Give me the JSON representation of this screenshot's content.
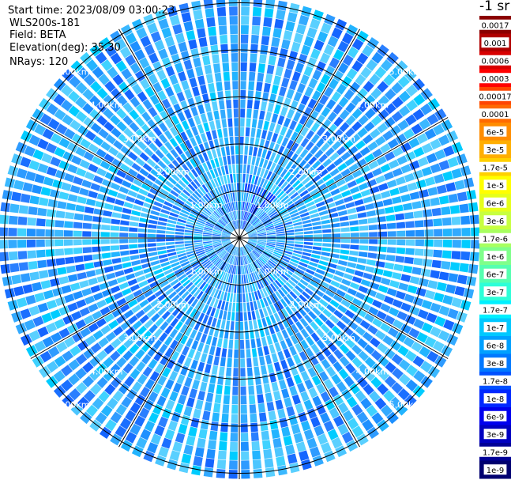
{
  "info": {
    "start_time": "Start time: 2023/08/09 03:00:23",
    "station": "WLS200s-181",
    "field": "Field: BETA",
    "elevation": "Elevation(deg): 35.30",
    "nrays": "NRays: 120"
  },
  "chart_data": {
    "type": "heatmap",
    "projection": "polar-ppi",
    "field": "BETA",
    "n_rays": 120,
    "elevation_deg": 35.3,
    "range_rings_km": [
      1,
      2,
      3,
      4,
      5
    ],
    "range_labels": [
      "1.00km",
      "2.00km",
      "3.00km",
      "4.00km",
      "5.00km"
    ],
    "grid": true,
    "colorbar": {
      "unit_label": "-1 sr",
      "placement": "right",
      "ticks": [
        "0.0017",
        "0.001",
        "0.0006",
        "0.0003",
        "0.00017",
        "0.0001",
        "6e-5",
        "3e-5",
        "1.7e-5",
        "1e-5",
        "6e-6",
        "3e-6",
        "1.7e-6",
        "1e-6",
        "6e-7",
        "3e-7",
        "1.7e-7",
        "1e-7",
        "6e-8",
        "3e-8",
        "1.7e-8",
        "1e-8",
        "6e-9",
        "3e-9",
        "1.7e-9",
        "1e-9"
      ],
      "colors": [
        "#8b0000",
        "#b00000",
        "#d80000",
        "#ff0000",
        "#ff4500",
        "#ff6a00",
        "#ff8c00",
        "#ffae00",
        "#ffd000",
        "#ffff00",
        "#e6ff1a",
        "#c8ff40",
        "#a8ff60",
        "#7fff8a",
        "#55ffb0",
        "#2dffd8",
        "#00f0ff",
        "#00c8ff",
        "#00a0ff",
        "#0078ff",
        "#0050ff",
        "#0028ff",
        "#0000ee",
        "#0000c0",
        "#000096",
        "#000070"
      ]
    }
  }
}
